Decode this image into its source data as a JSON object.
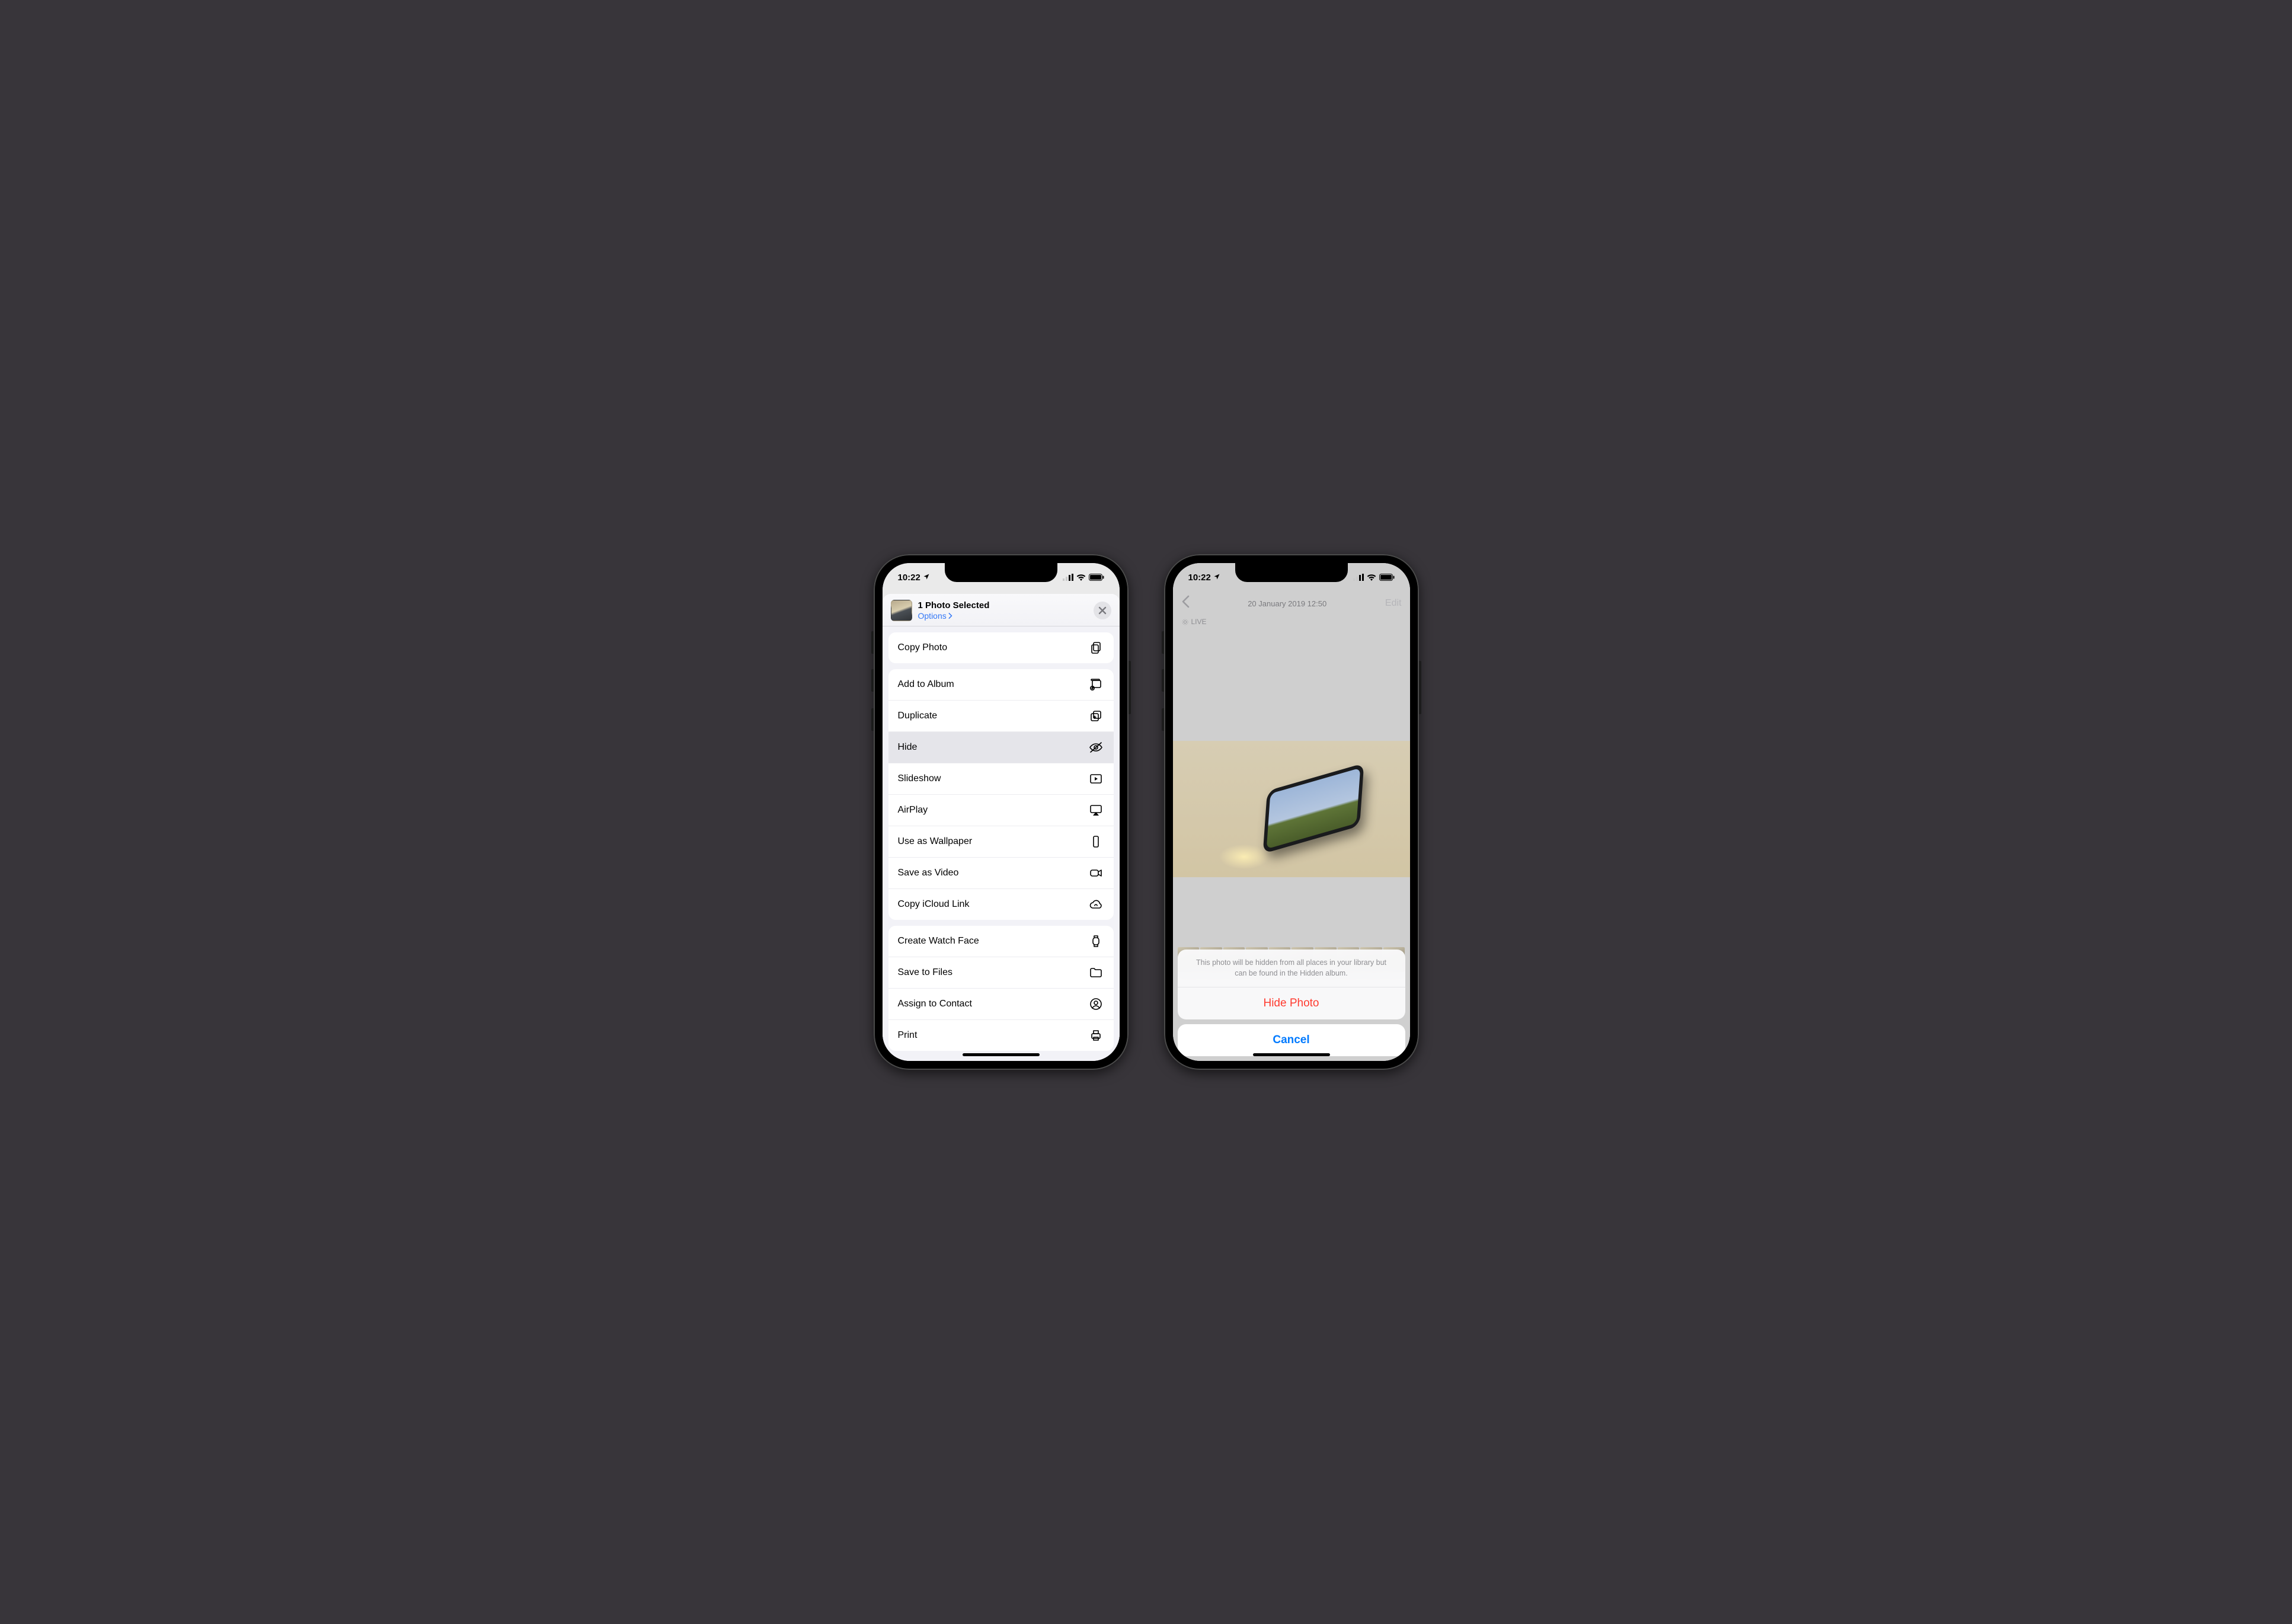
{
  "status": {
    "time": "10:22",
    "location_icon": "location-arrow"
  },
  "left": {
    "header": {
      "title": "1 Photo Selected",
      "options_label": "Options"
    },
    "groups": [
      {
        "rows": [
          {
            "key": "copy_photo",
            "label": "Copy Photo",
            "icon": "copy"
          }
        ]
      },
      {
        "rows": [
          {
            "key": "add_to_album",
            "label": "Add to Album",
            "icon": "album-add"
          },
          {
            "key": "duplicate",
            "label": "Duplicate",
            "icon": "duplicate"
          },
          {
            "key": "hide",
            "label": "Hide",
            "icon": "eye-slash",
            "selected": true
          },
          {
            "key": "slideshow",
            "label": "Slideshow",
            "icon": "play-rect"
          },
          {
            "key": "airplay",
            "label": "AirPlay",
            "icon": "airplay"
          },
          {
            "key": "wallpaper",
            "label": "Use as Wallpaper",
            "icon": "phone-rect"
          },
          {
            "key": "save_video",
            "label": "Save as Video",
            "icon": "video"
          },
          {
            "key": "icloud_link",
            "label": "Copy iCloud Link",
            "icon": "cloud-link"
          }
        ]
      },
      {
        "rows": [
          {
            "key": "watch_face",
            "label": "Create Watch Face",
            "icon": "watch"
          },
          {
            "key": "save_files",
            "label": "Save to Files",
            "icon": "folder"
          },
          {
            "key": "assign_contact",
            "label": "Assign to Contact",
            "icon": "person-circle"
          },
          {
            "key": "print",
            "label": "Print",
            "icon": "printer"
          }
        ]
      }
    ]
  },
  "right": {
    "nav": {
      "title": "20 January 2019  12:50",
      "edit_label": "Edit"
    },
    "live_label": "LIVE",
    "action_sheet": {
      "message": "This photo will be hidden from all places in your library but can be found in the Hidden album.",
      "destructive_label": "Hide Photo",
      "cancel_label": "Cancel"
    }
  }
}
